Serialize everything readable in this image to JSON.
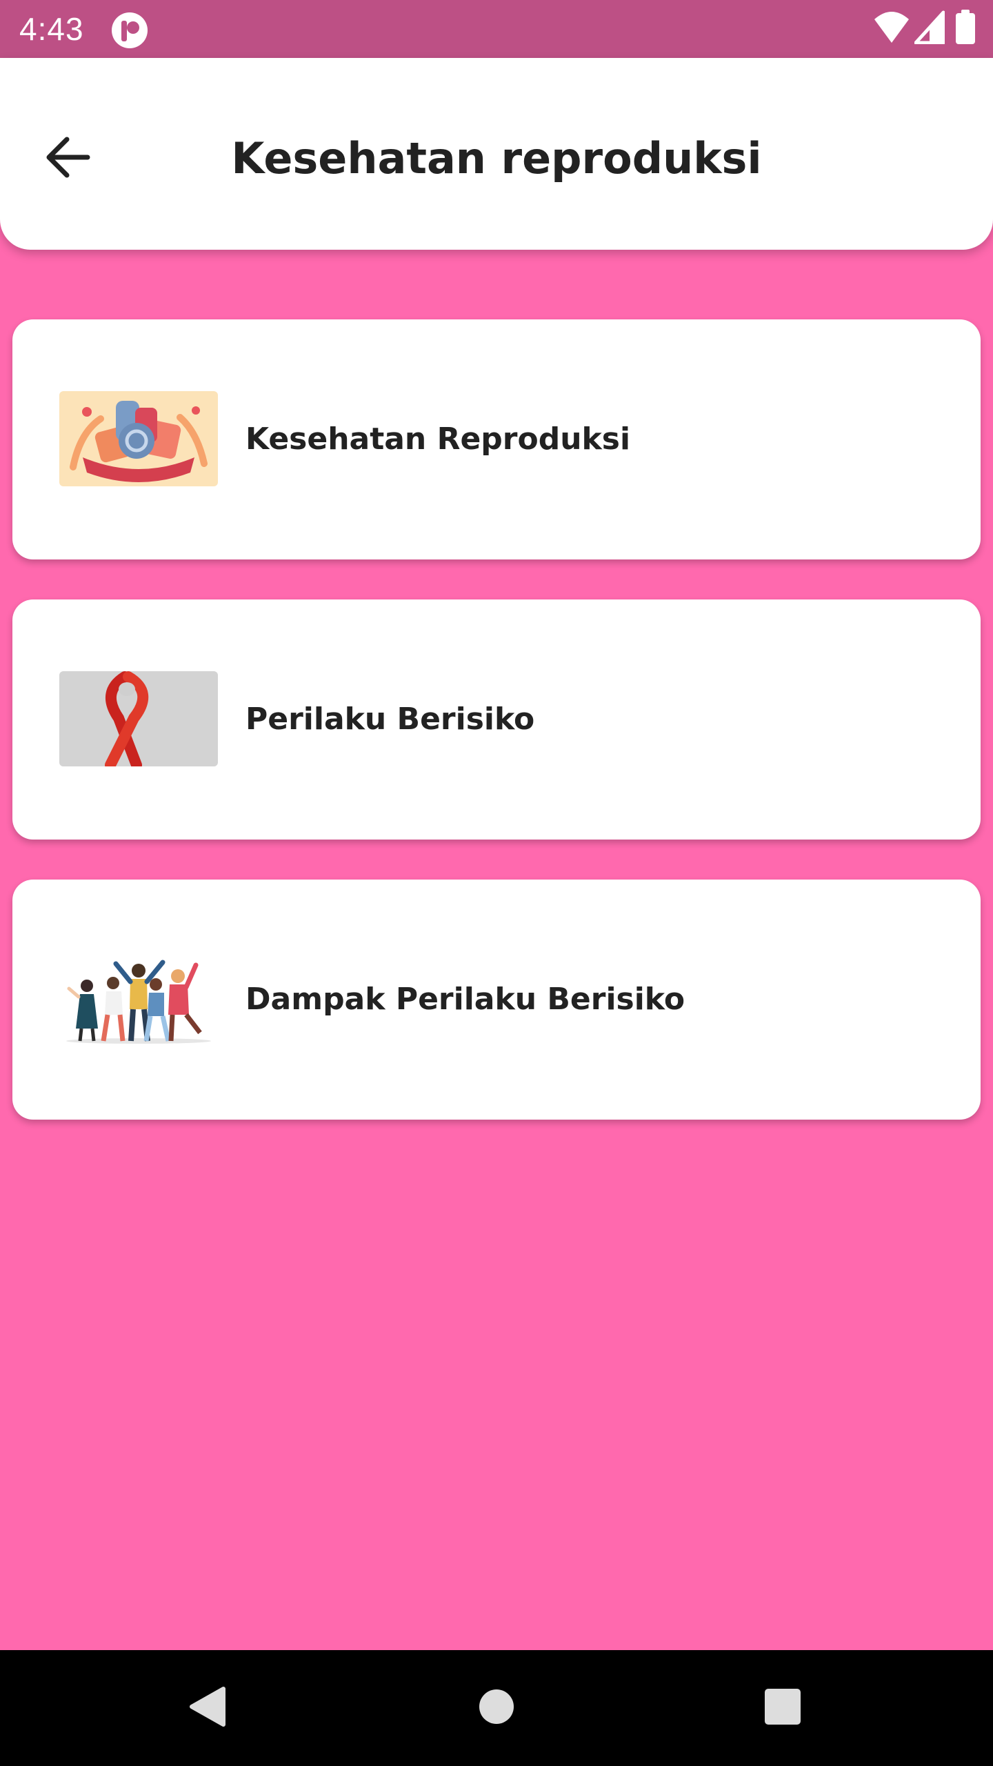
{
  "status_bar": {
    "time": "4:43",
    "icons": [
      "app-notification-icon",
      "wifi-icon",
      "cell-signal-icon",
      "battery-icon"
    ]
  },
  "app_bar": {
    "title": "Kesehatan reproduksi",
    "back_icon": "arrow-left-icon"
  },
  "menu": {
    "items": [
      {
        "label": "Kesehatan Reproduksi",
        "thumbnail": "sexual-health-day-illustration"
      },
      {
        "label": "Perilaku Berisiko",
        "thumbnail": "red-awareness-ribbon-photo"
      },
      {
        "label": "Dampak Perilaku Berisiko",
        "thumbnail": "group-of-young-people-illustration"
      }
    ]
  },
  "nav_bar": {
    "buttons": [
      "back-triangle-icon",
      "home-circle-icon",
      "recents-square-icon"
    ]
  },
  "colors": {
    "background": "#FF69AE",
    "status_bar": "#BD5085",
    "card": "#FFFFFF",
    "text": "#222222"
  }
}
